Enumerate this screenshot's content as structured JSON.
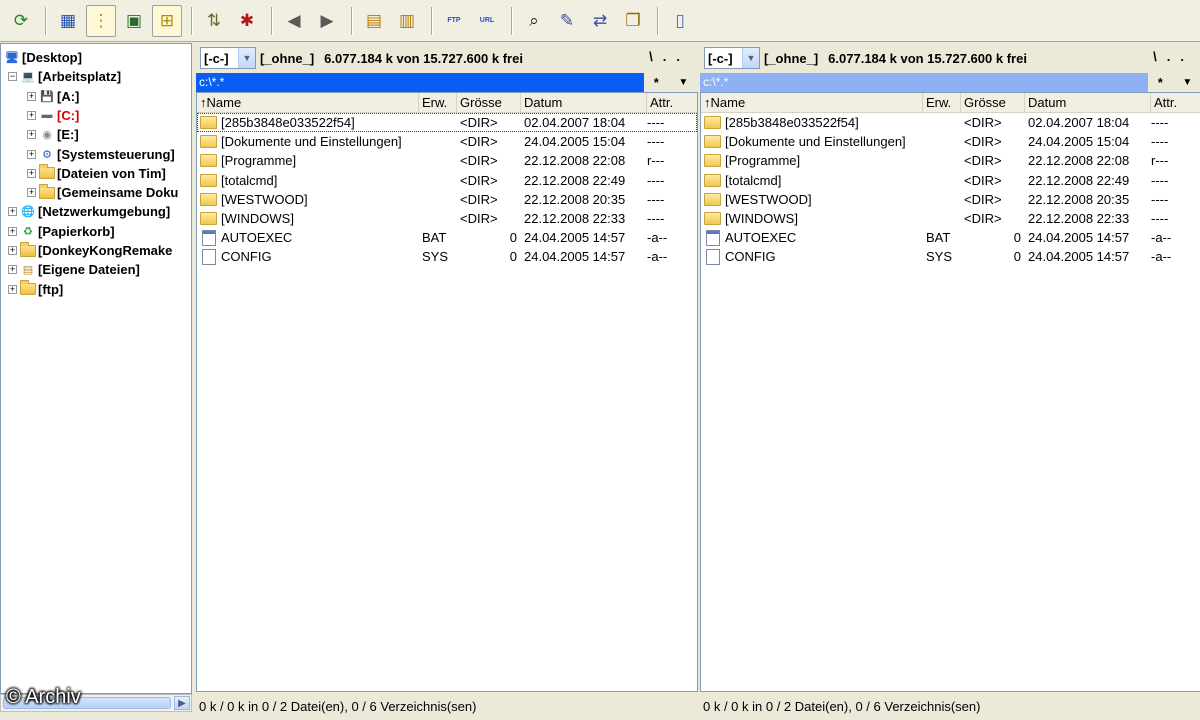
{
  "toolbar": {
    "buttons": [
      {
        "name": "refresh-icon",
        "glyph": "⟳"
      },
      {
        "name": "brief-view-icon",
        "glyph": "▦"
      },
      {
        "name": "full-view-icon",
        "glyph": "⋮",
        "pressed": true
      },
      {
        "name": "thumbnail-view-icon",
        "glyph": "▣"
      },
      {
        "name": "tree-view-icon",
        "glyph": "⊞",
        "pressed": true
      },
      {
        "name": "invert-selection-icon",
        "glyph": "⇅"
      },
      {
        "name": "select-all-icon",
        "glyph": "✱"
      },
      {
        "name": "back-icon",
        "glyph": "◀"
      },
      {
        "name": "forward-icon",
        "glyph": "▶"
      },
      {
        "name": "pack-icon",
        "glyph": "▤"
      },
      {
        "name": "unpack-icon",
        "glyph": "▥"
      },
      {
        "name": "ftp-connect-icon",
        "text": "FTP"
      },
      {
        "name": "ftp-url-icon",
        "text": "URL"
      },
      {
        "name": "search-icon",
        "glyph": "⌕"
      },
      {
        "name": "multi-rename-icon",
        "glyph": "✎"
      },
      {
        "name": "sync-dirs-icon",
        "glyph": "⇄"
      },
      {
        "name": "copy-names-icon",
        "glyph": "❐"
      },
      {
        "name": "notepad-icon",
        "glyph": "▯"
      }
    ]
  },
  "tree": {
    "items": [
      {
        "label": "[Desktop]",
        "icon": "desktop-icon",
        "level": 0
      },
      {
        "label": "[Arbeitsplatz]",
        "icon": "my-computer-icon",
        "level": 1,
        "expanded": true
      },
      {
        "label": "[A:]",
        "icon": "floppy-drive-icon",
        "level": 2
      },
      {
        "label": "[C:]",
        "icon": "hard-drive-icon",
        "level": 2,
        "red": true
      },
      {
        "label": "[E:]",
        "icon": "cd-drive-icon",
        "level": 2
      },
      {
        "label": "[Systemsteuerung]",
        "icon": "control-panel-icon",
        "level": 2
      },
      {
        "label": "[Dateien von Tim]",
        "icon": "folder-icon",
        "level": 2
      },
      {
        "label": "[Gemeinsame Doku",
        "icon": "folder-icon",
        "level": 2
      },
      {
        "label": "[Netzwerkumgebung]",
        "icon": "network-icon",
        "level": 1
      },
      {
        "label": "[Papierkorb]",
        "icon": "recycle-bin-icon",
        "level": 1
      },
      {
        "label": "[DonkeyKongRemake",
        "icon": "folder-icon",
        "level": 1
      },
      {
        "label": "[Eigene Dateien]",
        "icon": "documents-icon",
        "level": 1
      },
      {
        "label": "[ftp]",
        "icon": "folder-icon",
        "level": 1
      }
    ]
  },
  "watermark": "© Archiv",
  "panels": [
    {
      "drive": "[-c-]",
      "label": "[_ohne_]",
      "free": "6.077.184 k von 15.727.600 k frei",
      "nav_root": "\\",
      "nav_up": "..",
      "path": "c:\\*.*",
      "path_active": true,
      "filter": "*",
      "filter_arrow": "▼",
      "status": "0 k / 0 k in 0 / 2 Datei(en), 0 / 6 Verzeichnis(sen)"
    },
    {
      "drive": "[-c-]",
      "label": "[_ohne_]",
      "free": "6.077.184 k von 15.727.600 k frei",
      "nav_root": "\\",
      "nav_up": "..",
      "path": "c:\\*.*",
      "path_active": false,
      "filter": "*",
      "filter_arrow": "▼",
      "status": "0 k / 0 k in 0 / 2 Datei(en), 0 / 6 Verzeichnis(sen)"
    }
  ],
  "columns": {
    "name": "↑Name",
    "ext": "Erw.",
    "size": "Grösse",
    "date": "Datum",
    "attr": "Attr."
  },
  "files": [
    {
      "name": "[285b3848e033522f54]",
      "ext": "",
      "size": "<DIR>",
      "date": "02.04.2007 18:04",
      "attr": "----",
      "type": "folder"
    },
    {
      "name": "[Dokumente und Einstellungen]",
      "ext": "",
      "size": "<DIR>",
      "date": "24.04.2005 15:04",
      "attr": "----",
      "type": "folder"
    },
    {
      "name": "[Programme]",
      "ext": "",
      "size": "<DIR>",
      "date": "22.12.2008 22:08",
      "attr": "r---",
      "type": "folder"
    },
    {
      "name": "[totalcmd]",
      "ext": "",
      "size": "<DIR>",
      "date": "22.12.2008 22:49",
      "attr": "----",
      "type": "folder"
    },
    {
      "name": "[WESTWOOD]",
      "ext": "",
      "size": "<DIR>",
      "date": "22.12.2008 20:35",
      "attr": "----",
      "type": "folder"
    },
    {
      "name": "[WINDOWS]",
      "ext": "",
      "size": "<DIR>",
      "date": "22.12.2008 22:33",
      "attr": "----",
      "type": "folder"
    },
    {
      "name": "AUTOEXEC",
      "ext": "BAT",
      "size": "0",
      "date": "24.04.2005 14:57",
      "attr": "-a--",
      "type": "bat"
    },
    {
      "name": "CONFIG",
      "ext": "SYS",
      "size": "0",
      "date": "24.04.2005 14:57",
      "attr": "-a--",
      "type": "file"
    }
  ]
}
